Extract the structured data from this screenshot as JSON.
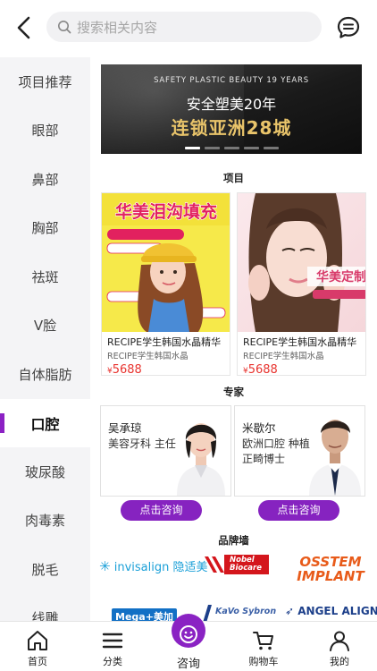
{
  "search": {
    "placeholder": "搜索相关内容"
  },
  "sidebar": {
    "items": [
      {
        "label": "项目推荐"
      },
      {
        "label": "眼部"
      },
      {
        "label": "鼻部"
      },
      {
        "label": "胸部"
      },
      {
        "label": "祛斑"
      },
      {
        "label": "V脸"
      },
      {
        "label": "自体脂肪"
      },
      {
        "label": "口腔",
        "active": true
      },
      {
        "label": "玻尿酸"
      },
      {
        "label": "肉毒素"
      },
      {
        "label": "脱毛"
      },
      {
        "label": "线雕"
      }
    ]
  },
  "banner": {
    "line1": "SAFETY PLASTIC BEAUTY 19 YEARS",
    "line2": "安全塑美20年",
    "line3": "连锁亚洲28城",
    "dot_count": 5,
    "active_dot": 0
  },
  "sections": {
    "projects": "项目",
    "experts": "专家",
    "brands": "品牌墙"
  },
  "projects": [
    {
      "poster_text": "华美泪沟填充",
      "name": "RECIPE学生韩国水晶精华",
      "sub": "RECIPE学生韩国水晶",
      "currency": "¥",
      "price": "5688"
    },
    {
      "poster_text": "华美定制",
      "name": "RECIPE学生韩国水晶精华",
      "sub": "RECIPE学生韩国水晶",
      "currency": "¥",
      "price": "5688"
    }
  ],
  "experts": [
    {
      "name": "吴承琼",
      "title": "美容牙科 主任",
      "button": "点击咨询"
    },
    {
      "name": "米歇尔",
      "title": "欧洲口腔 种植正畸博士",
      "button": "点击咨询"
    }
  ],
  "brands": {
    "items": [
      "invisalign 隐适美",
      "Nobel Biocare",
      "OSSTEM IMPLANT",
      "Mega+美加",
      "KaVo Sybron",
      "ANGEL ALIGN"
    ],
    "colors": {
      "invisalign": "#1ba0d8",
      "nobel": "#d4161c",
      "osstem": "#e85b1a",
      "mega": "#1270c5",
      "kavo": "#3a5fa6",
      "angel": "#1c3f8a"
    }
  },
  "tabbar": {
    "tabs": [
      {
        "label": "首页",
        "icon": "home-icon"
      },
      {
        "label": "分类",
        "icon": "list-icon"
      },
      {
        "label": "咨询",
        "icon": "smile-icon"
      },
      {
        "label": "购物车",
        "icon": "cart-icon"
      },
      {
        "label": "我的",
        "icon": "user-icon"
      }
    ],
    "accent": "#8a23c3"
  }
}
